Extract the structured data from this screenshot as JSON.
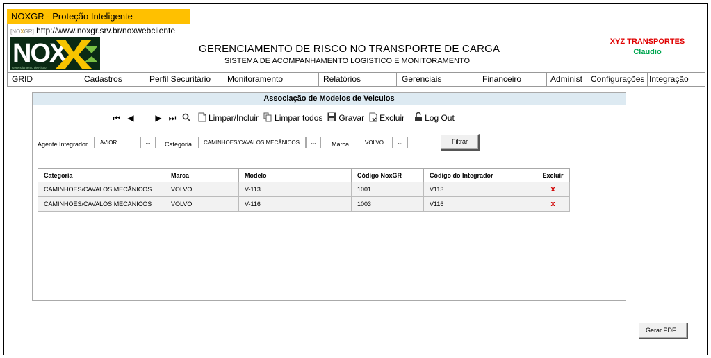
{
  "window": {
    "tab_title": "NOXGR - Proteção Inteligente",
    "url_tag_prefix": "[NO",
    "url_tag_mid": "X",
    "url_tag_suffix": "GR]",
    "url": "http://www.noxgr.srv.br/noxwebcliente"
  },
  "header": {
    "logo_text": "NOX",
    "logo_sub": "Gerenciamento de Risco",
    "title": "GERENCIAMENTO DE RISCO NO TRANSPORTE DE CARGA",
    "subtitle": "SISTEMA DE ACOMPANHAMENTO LOGISTICO  E MONITORAMENTO",
    "company": "XYZ TRANSPORTES",
    "user": "Claudio",
    "company_color": "#e00000",
    "user_color": "#00a651"
  },
  "menu": [
    {
      "label": "GRID"
    },
    {
      "label": "Cadastros"
    },
    {
      "label": "Perfil Securitário"
    },
    {
      "label": "Monitoramento"
    },
    {
      "label": "Relatórios"
    },
    {
      "label": "Gerenciais"
    },
    {
      "label": "Financeiro"
    },
    {
      "label": "Administ"
    },
    {
      "label": "Configurações"
    },
    {
      "label": "Integração"
    }
  ],
  "panel": {
    "title": "Associação de Modelos de Veiculos"
  },
  "toolbar": {
    "first_icon": "first-record-icon",
    "prev_icon": "previous-record-icon",
    "equal_icon": "equal-icon",
    "next_icon": "next-record-icon",
    "last_icon": "last-record-icon",
    "search_icon": "search-icon",
    "limpar_incluir": "Limpar/Incluir",
    "limpar_todos": "Limpar todos",
    "gravar": "Gravar",
    "excluir": "Excluir",
    "logout": "Log Out"
  },
  "filters": {
    "agente_label": "Agente Integrador",
    "agente_value": "AVIOR",
    "categoria_label": "Categoria",
    "categoria_value": "CAMINHOES/CAVALOS MECÂNICOS",
    "marca_label": "Marca",
    "marca_value": "VOLVO",
    "dots": "...",
    "filtrar_button": "Filtrar"
  },
  "table": {
    "headers": {
      "categoria": "Categoria",
      "marca": "Marca",
      "modelo": "Modelo",
      "codigo_noxgr": "Código NoxGR",
      "codigo_integrador": "Código do Integrador",
      "excluir": "Excluir"
    },
    "rows": [
      {
        "categoria": "CAMINHOES/CAVALOS MECÂNICOS",
        "marca": "VOLVO",
        "modelo": "V-113",
        "codigo_noxgr": "1001",
        "codigo_integrador": "V113",
        "excluir": "x"
      },
      {
        "categoria": "CAMINHOES/CAVALOS MECÂNICOS",
        "marca": "VOLVO",
        "modelo": "V-116",
        "codigo_noxgr": "1003",
        "codigo_integrador": "V116",
        "excluir": "x"
      }
    ]
  },
  "footer": {
    "gerar_pdf": "Gerar PDF..."
  }
}
